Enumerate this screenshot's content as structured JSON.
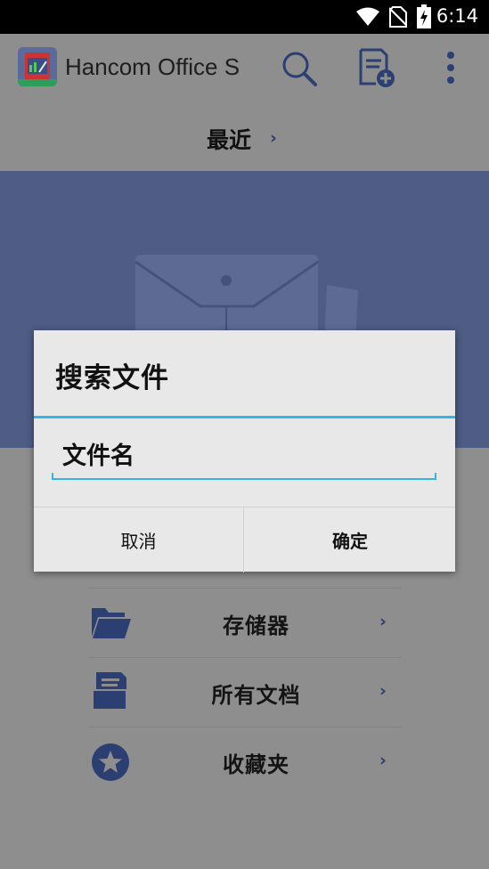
{
  "status_bar": {
    "time": "6:14",
    "icons": [
      "wifi-icon",
      "no-sim-icon",
      "battery-charging-icon"
    ]
  },
  "app_bar": {
    "title": "Hancom Office S",
    "icons": [
      "app-logo",
      "search-icon",
      "new-document-icon",
      "overflow-menu-icon"
    ]
  },
  "recent": {
    "label": "最近",
    "chevron": "›"
  },
  "list": {
    "items": [
      {
        "label": "存储器",
        "icon": "folder-icon",
        "chevron": "›"
      },
      {
        "label": "所有文档",
        "icon": "documents-icon",
        "chevron": "›"
      },
      {
        "label": "收藏夹",
        "icon": "star-icon",
        "chevron": "›"
      }
    ]
  },
  "dialog": {
    "title": "搜索文件",
    "input_placeholder": "文件名",
    "input_value": "",
    "cancel_label": "取消",
    "ok_label": "确定"
  },
  "colors": {
    "accent": "#33b5e5",
    "brand_blue": "#4e5c86",
    "chevron": "#2c3f73"
  }
}
